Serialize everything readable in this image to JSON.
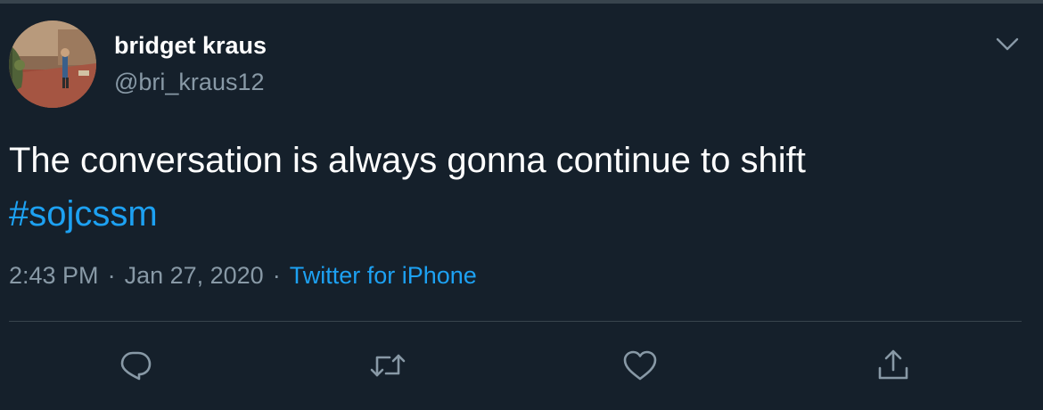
{
  "tweet": {
    "author": {
      "display_name": "bridget kraus",
      "handle": "@bri_kraus12"
    },
    "text": "The conversation is always gonna continue to shift",
    "hashtag": "#sojcssm",
    "time": "2:43 PM",
    "date": "Jan 27, 2020",
    "separator": "·",
    "source": "Twitter for iPhone"
  },
  "icons": {
    "menu": "chevron-down-icon",
    "reply": "reply-icon",
    "retweet": "retweet-icon",
    "like": "heart-icon",
    "share": "share-icon"
  },
  "colors": {
    "background": "#15202b",
    "text": "#ffffff",
    "muted": "#8899a6",
    "accent": "#1da1f2",
    "border": "#38444d"
  }
}
